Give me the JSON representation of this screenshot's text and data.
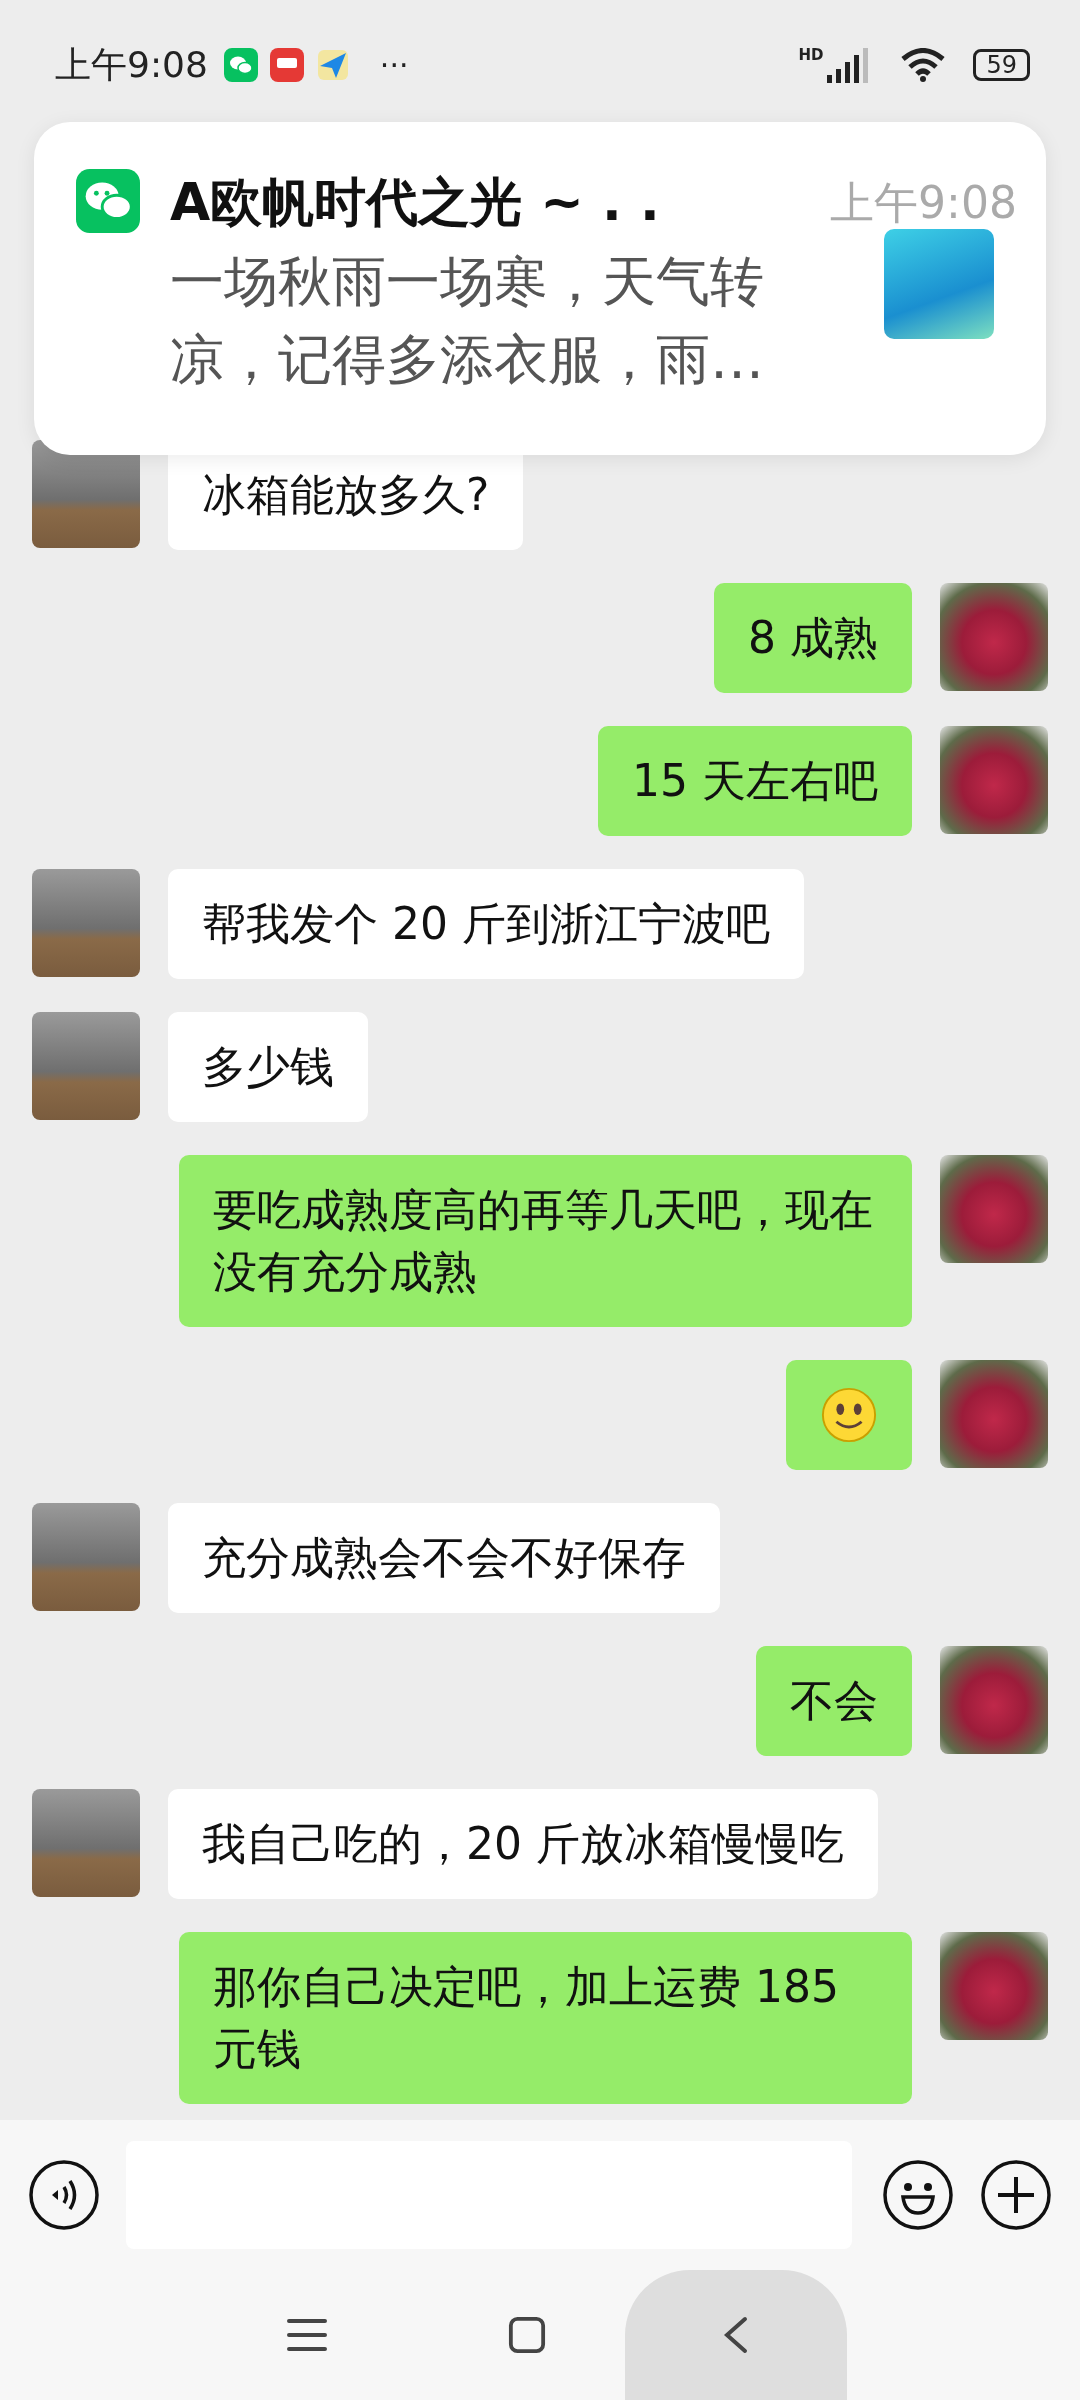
{
  "status_bar": {
    "time": "上午9:08",
    "more": "···",
    "network": "HD",
    "battery": "59"
  },
  "notification": {
    "title": "A欧帆时代之光 ~ . .",
    "time": "上午9:08",
    "body": "一场秋雨一场寒，天气转凉，记得多添衣服，雨…"
  },
  "messages": [
    {
      "outgoing": false,
      "kind": "text",
      "text": "冰箱能放多久?"
    },
    {
      "outgoing": true,
      "kind": "text",
      "text": "8 成熟"
    },
    {
      "outgoing": true,
      "kind": "text",
      "text": "15 天左右吧"
    },
    {
      "outgoing": false,
      "kind": "text",
      "text": "帮我发个 20 斤到浙江宁波吧"
    },
    {
      "outgoing": false,
      "kind": "text",
      "text": "多少钱"
    },
    {
      "outgoing": true,
      "kind": "text",
      "text": "要吃成熟度高的再等几天吧，现在没有充分成熟"
    },
    {
      "outgoing": true,
      "kind": "emoji"
    },
    {
      "outgoing": false,
      "kind": "text",
      "text": "充分成熟会不会不好保存"
    },
    {
      "outgoing": true,
      "kind": "text",
      "text": "不会"
    },
    {
      "outgoing": false,
      "kind": "text",
      "text": "我自己吃的，20 斤放冰箱慢慢吃"
    },
    {
      "outgoing": true,
      "kind": "text",
      "text": "那你自己决定吧，加上运费 185 元钱"
    }
  ]
}
